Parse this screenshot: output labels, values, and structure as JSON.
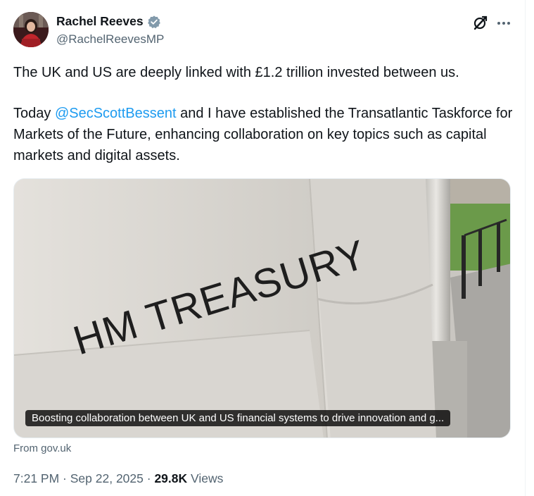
{
  "author": {
    "display_name": "Rachel Reeves",
    "handle": "@RachelReevesMP",
    "verified_color": "#829aab"
  },
  "tweet": {
    "line1": "The UK and US are deeply linked with £1.2 trillion invested between us.",
    "para2_before": "Today ",
    "mention": "@SecScottBessent",
    "para2_after": " and I have established the Transatlantic Taskforce for Markets of the Future, enhancing collaboration on key topics such as capital markets and digital assets."
  },
  "card": {
    "image_text": "HM TREASURY",
    "caption": "Boosting collaboration between UK and US financial systems to drive innovation and g..."
  },
  "source": "From gov.uk",
  "meta": {
    "time": "7:21 PM",
    "separator": " · ",
    "date": "Sep 22, 2025",
    "views_count": "29.8K",
    "views_label": "Views"
  },
  "icons": {
    "grok": "grok-icon",
    "more": "more-horizontal-icon",
    "verified": "verified-badge-icon"
  },
  "colors": {
    "link": "#1d9bf0",
    "secondary_text": "#536471",
    "primary_text": "#0f1419"
  }
}
